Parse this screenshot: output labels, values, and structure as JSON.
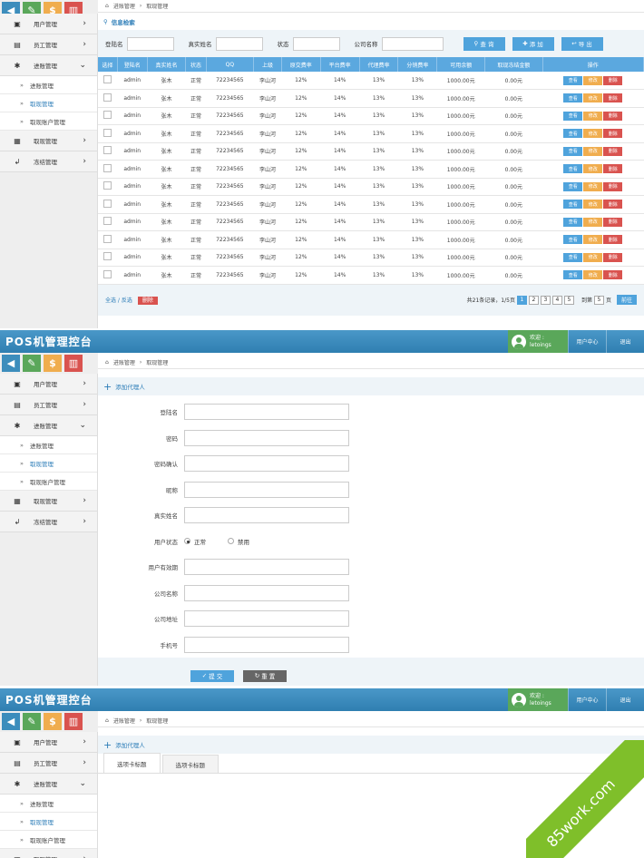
{
  "app": {
    "title": "POS机管理控台",
    "welcome_line1": "欢迎 :",
    "welcome_line2": "letoings",
    "user_center": "用户中心",
    "logout": "退出"
  },
  "breadcrumb": {
    "section": "进账管理",
    "page": "取现管理"
  },
  "sidebar": {
    "items": [
      {
        "label": "用户管理",
        "icon": "user-card-icon"
      },
      {
        "label": "员工管理",
        "icon": "staff-icon"
      },
      {
        "label": "进账管理",
        "icon": "gear-icon"
      },
      {
        "label": "取现管理",
        "icon": "calculator-icon"
      },
      {
        "label": "冻结管理",
        "icon": "freeze-icon"
      }
    ],
    "subitems": [
      "进账管理",
      "取现管理",
      "取现账户管理"
    ]
  },
  "colors": {
    "primary": "#3c8dbc",
    "green": "#5aa75a",
    "orange": "#f0ad4e",
    "red": "#d9534f"
  },
  "search": {
    "title": "信息检索",
    "fields": [
      "登陆名",
      "真实姓名",
      "状态",
      "公司名称"
    ],
    "buttons": [
      "查 询",
      "添 加",
      "导 出"
    ]
  },
  "table": {
    "headers": [
      "选择",
      "登陆名",
      "真实姓名",
      "状态",
      "QQ",
      "上级",
      "原交费率",
      "平台费率",
      "代理费率",
      "分销费率",
      "可用余额",
      "取现冻结金额",
      "操作"
    ],
    "row": [
      "admin",
      "张木",
      "正常",
      "72234565",
      "李山河",
      "12%",
      "14%",
      "13%",
      "13%",
      "1000.00元",
      "0.00元"
    ],
    "row_count": 12,
    "ops": [
      "查看",
      "修改",
      "删除"
    ]
  },
  "table_footer": {
    "select": "全选 / 反选",
    "delete": "删除",
    "summary": "共21条记录，1/5页",
    "pages": [
      "1",
      "2",
      "3",
      "4",
      "5"
    ],
    "goto_prefix": "到第",
    "goto_value": "5",
    "goto_suffix": "页",
    "go": "前往"
  },
  "add_form": {
    "title": "添加代理人",
    "fields": [
      "登陆名",
      "密码",
      "密码确认",
      "昵称",
      "真实姓名",
      "用户状态",
      "用户有效期",
      "公司名称",
      "公司地址",
      "手机号"
    ],
    "status_options": [
      "正常",
      "禁用"
    ],
    "submit": "提 交",
    "reset": "重 置"
  },
  "tabs_panel": {
    "title": "添加代理人",
    "tabs": [
      "选项卡标题",
      "选项卡标题"
    ]
  },
  "watermark": "85work.com"
}
